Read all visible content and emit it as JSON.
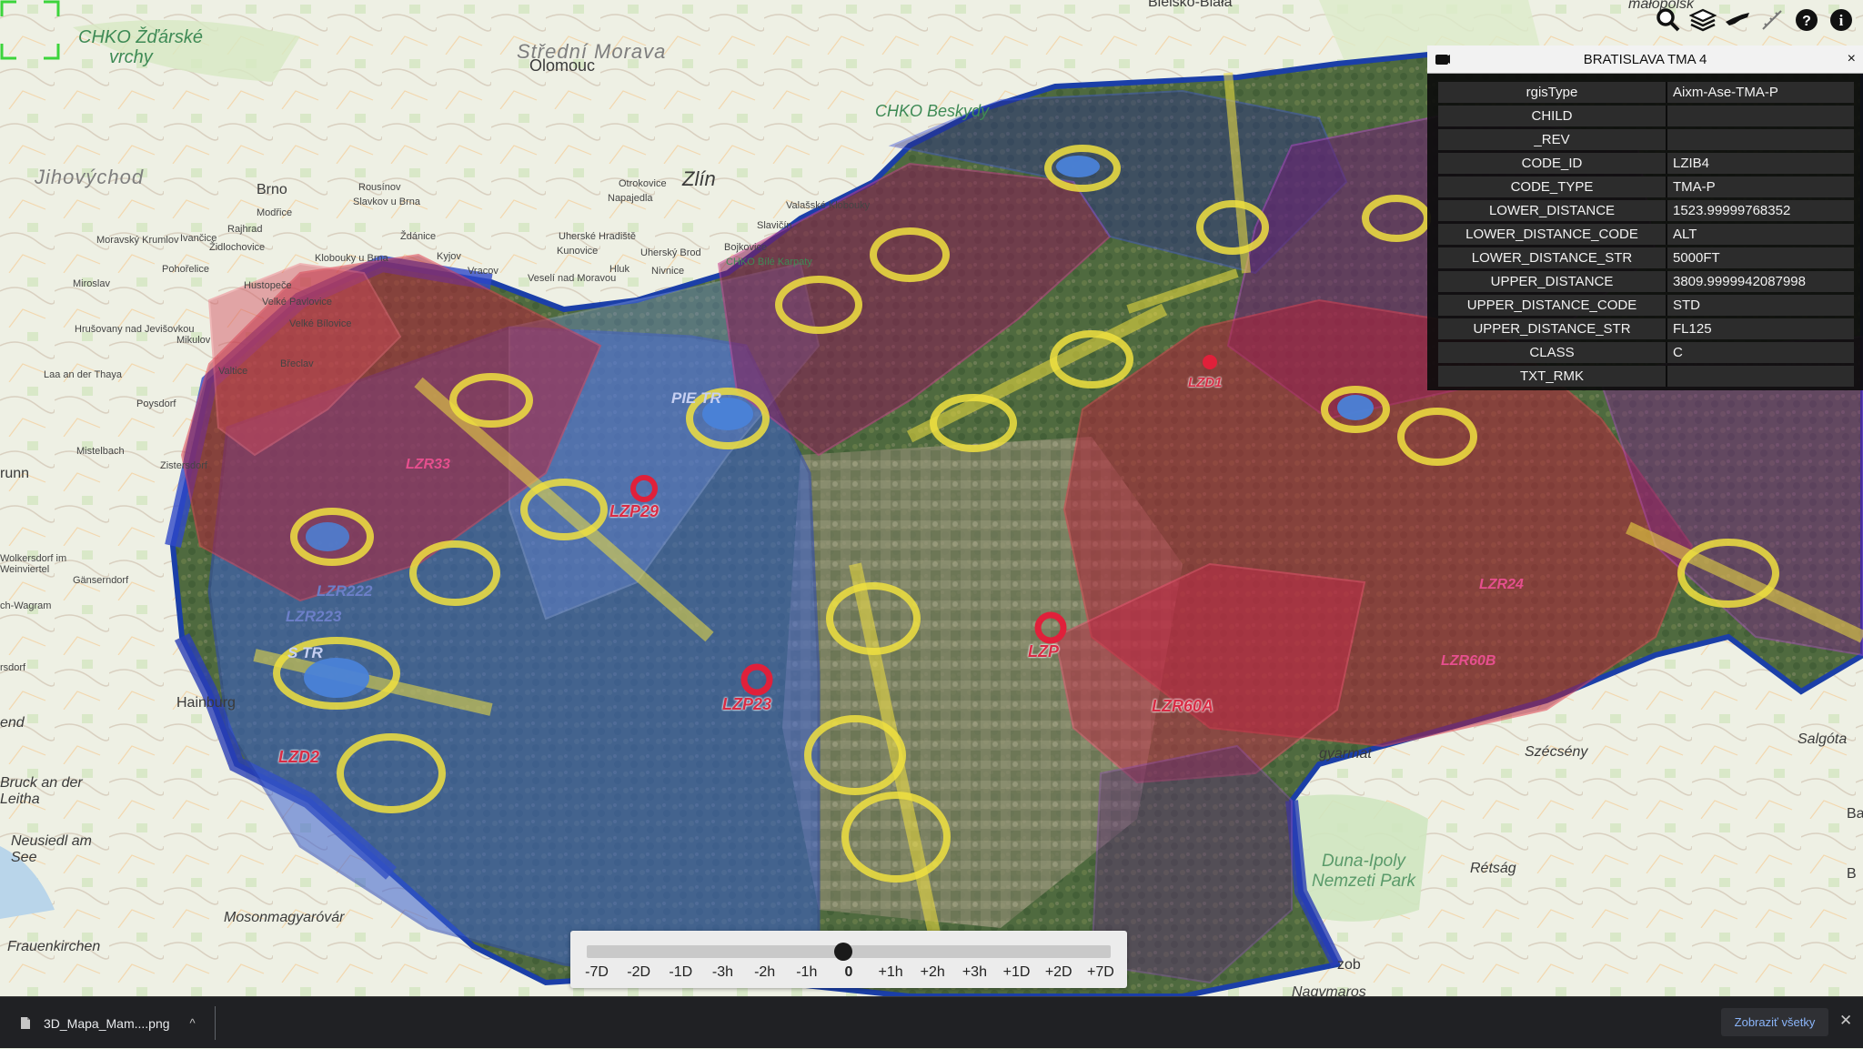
{
  "map": {
    "labels": {
      "bielsko": "Bielsko-Biała",
      "malopolsk": "małopolsk",
      "chko_zdarske": "CHKO Žďárské",
      "vrchy": "vrchy",
      "stredni_morava": "Střední Morava",
      "olomouc": "Olomouc",
      "chko_beskydy": "CHKO Beskydy",
      "jihovychod": "Jihovýchod",
      "zlin": "Zlín",
      "brno": "Brno",
      "rousinov": "Rousínov",
      "modrice": "Modřice",
      "slavkov": "Slavkov u Brna",
      "rajhrad": "Rajhrad",
      "otrokovice": "Otrokovice",
      "napajedla": "Napajedla",
      "zidlochovice": "Židlochovice",
      "zdanice": "Ždánice",
      "moravsky_krumlov": "Moravský Krumlov",
      "ivancice": "Ivančice",
      "kyjov": "Kyjov",
      "klobouky": "Klobouky u Brna",
      "valasske_klobouky": "Valašské Klobouky",
      "slavicin": "Slavičín",
      "uherske_hradiste": "Uherské Hradiště",
      "uhersky_brod": "Uherský Brod",
      "bojkovice": "Bojkovice",
      "chko_biele": "CHKO Bílé Karpaty",
      "kunovice": "Kunovice",
      "veseli": "Veselí nad Moravou",
      "nivnice": "Nivnice",
      "hluk": "Hluk",
      "vracov": "Vracov",
      "pohorelice": "Pohořelice",
      "hustopece": "Hustopeče",
      "velke_pavlovice": "Velké Pavlovice",
      "miroslav": "Miroslav",
      "velke_bilovice": "Velké Bílovice",
      "hrusovany": "Hrušovany nad Jevišovkou",
      "laa": "Laa an der Thaya",
      "mikulov": "Mikulov",
      "valtice": "Valtice",
      "breclav": "Břeclav",
      "poysdorf": "Poysdorf",
      "mistelbach": "Mistelbach",
      "zistersdorf": "Zistersdorf",
      "wolkersdorf": "Wolkersdorf im Weinviertel",
      "gansendorf": "Gänserndorf",
      "wagram": "ch-Wagram",
      "rsdorf": "rsdorf",
      "hainburg": "Hainburg",
      "bruck": "Bruck an der Leitha",
      "neusiedl": "Neusiedl am See",
      "mosonmagyarovar": "Mosonmagyaróvár",
      "frauenkirchen": "Frauenkirchen",
      "end": "end",
      "runn": "runn",
      "salgota": "Salgóta",
      "gyarmat": "gyarmat",
      "szecseny": "Szécsény",
      "duna_ipoly": "Duna-Ipoly Nemzeti Park",
      "retsag": "Rétság",
      "szob": "zob",
      "nagymaros": "Nagymaros",
      "ba": "Ba",
      "b": "B"
    },
    "zones": {
      "lzp29": "LZP29",
      "lzp23": "LZP23",
      "lzd2": "LZD2",
      "lzr222": "LZR222",
      "lzr223": "LZR223",
      "lzr33": "LZR33",
      "lzr24": "LZR24",
      "lzr60a": "LZR60A",
      "lzr60b": "LZR60B",
      "lzd1": "LZD1",
      "lzp_short": "LZP",
      "pie_tr": "PIE          TR",
      "s_tr": "S              TR"
    }
  },
  "toolbar": {
    "buttons": [
      {
        "name": "search",
        "icon": "search-icon"
      },
      {
        "name": "layers",
        "icon": "layers-icon"
      },
      {
        "name": "aircraft",
        "icon": "aircraft-icon"
      },
      {
        "name": "measure",
        "icon": "measure-icon"
      },
      {
        "name": "help",
        "icon": "help-icon"
      },
      {
        "name": "info",
        "icon": "info-icon"
      }
    ]
  },
  "info_panel": {
    "title": "BRATISLAVA TMA 4",
    "close": "×",
    "rows": [
      {
        "key": "rgisType",
        "value": "Aixm-Ase-TMA-P"
      },
      {
        "key": "CHILD",
        "value": ""
      },
      {
        "key": "_REV",
        "value": ""
      },
      {
        "key": "CODE_ID",
        "value": "LZIB4"
      },
      {
        "key": "CODE_TYPE",
        "value": "TMA-P"
      },
      {
        "key": "LOWER_DISTANCE",
        "value": "1523.99999768352"
      },
      {
        "key": "LOWER_DISTANCE_CODE",
        "value": "ALT"
      },
      {
        "key": "LOWER_DISTANCE_STR",
        "value": "5000FT"
      },
      {
        "key": "UPPER_DISTANCE",
        "value": "3809.9999942087998"
      },
      {
        "key": "UPPER_DISTANCE_CODE",
        "value": "STD"
      },
      {
        "key": "UPPER_DISTANCE_STR",
        "value": "FL125"
      },
      {
        "key": "CLASS",
        "value": "C"
      },
      {
        "key": "TXT_RMK",
        "value": ""
      }
    ]
  },
  "time_slider": {
    "ticks": [
      "-7D",
      "-2D",
      "-1D",
      "-3h",
      "-2h",
      "-1h",
      "0",
      "+1h",
      "+2h",
      "+3h",
      "+1D",
      "+2D",
      "+7D"
    ],
    "current": "0"
  },
  "download_bar": {
    "filename": "3D_Mapa_Mam....png",
    "chevron": "^",
    "show_all": "Zobraziť všetky",
    "close": "✕"
  },
  "colors": {
    "restricted_red": "#d82c45",
    "tma_blue": "#3a5fd0",
    "danger_purple": "#7b1f8a",
    "approach_yellow": "#f0e040",
    "info_panel_bg": "#0c0c0c",
    "download_bar_bg": "#202124",
    "show_all_link": "#8ab4f8"
  }
}
